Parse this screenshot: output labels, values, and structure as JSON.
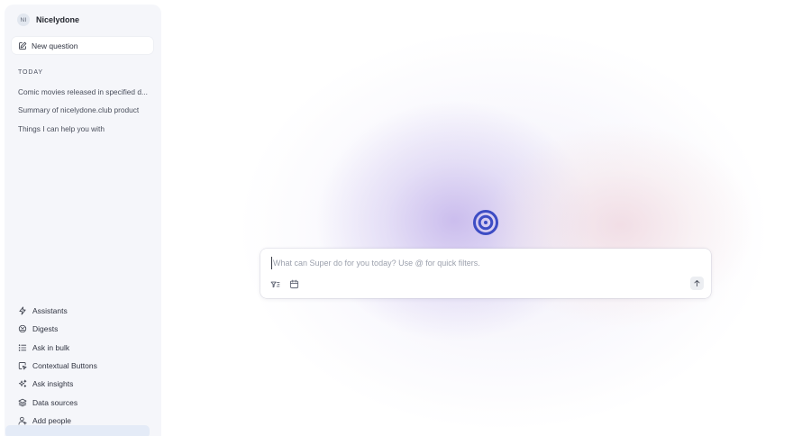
{
  "sidebar": {
    "workspace": {
      "avatar_initials": "NI",
      "name": "Nicelydone"
    },
    "new_question": {
      "label": "New question",
      "icon": "pencil-square-icon"
    },
    "section_label": "TODAY",
    "history": [
      {
        "label": "Comic movies released in specified d..."
      },
      {
        "label": "Summary of nicelydone.club product"
      },
      {
        "label": "Things I can help you with"
      }
    ],
    "nav": [
      {
        "label": "Assistants",
        "icon": "lightning-icon"
      },
      {
        "label": "Digests",
        "icon": "digest-icon"
      },
      {
        "label": "Ask in bulk",
        "icon": "list-icon"
      },
      {
        "label": "Contextual Buttons",
        "icon": "contextual-button-icon"
      },
      {
        "label": "Ask insights",
        "icon": "sparkles-icon"
      },
      {
        "label": "Data sources",
        "icon": "layers-icon"
      },
      {
        "label": "Add people",
        "icon": "add-user-icon"
      }
    ]
  },
  "composer": {
    "placeholder": "What can Super do for you today? Use @ for quick filters.",
    "value": ""
  },
  "colors": {
    "accent": "#3d4cc4",
    "sidebar_bg": "#f5f6fa"
  }
}
